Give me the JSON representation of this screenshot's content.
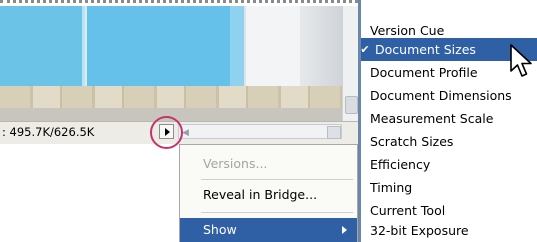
{
  "status_bar": {
    "size_text": ": 495.7K/626.5K"
  },
  "menu": {
    "items": [
      {
        "label": "Versions...",
        "enabled": false
      },
      {
        "label": "Reveal in Bridge...",
        "enabled": true
      },
      {
        "label": "Show",
        "enabled": true,
        "selected": true,
        "has_submenu": true
      }
    ]
  },
  "submenu": {
    "items": [
      {
        "label": "Version Cue",
        "checked": false
      },
      {
        "label": "Document Sizes",
        "checked": true,
        "selected": true
      },
      {
        "label": "Document Profile",
        "checked": false
      },
      {
        "label": "Document Dimensions",
        "checked": false
      },
      {
        "label": "Measurement Scale",
        "checked": false
      },
      {
        "label": "Scratch Sizes",
        "checked": false
      },
      {
        "label": "Efficiency",
        "checked": false
      },
      {
        "label": "Timing",
        "checked": false
      },
      {
        "label": "Current Tool",
        "checked": false
      },
      {
        "label": "32-bit Exposure",
        "checked": false
      }
    ],
    "check_glyph": "✔"
  },
  "colors": {
    "selection": "#2f5fa5",
    "highlight_ring": "#c5336e",
    "disabled_text": "#a4a4a4"
  }
}
